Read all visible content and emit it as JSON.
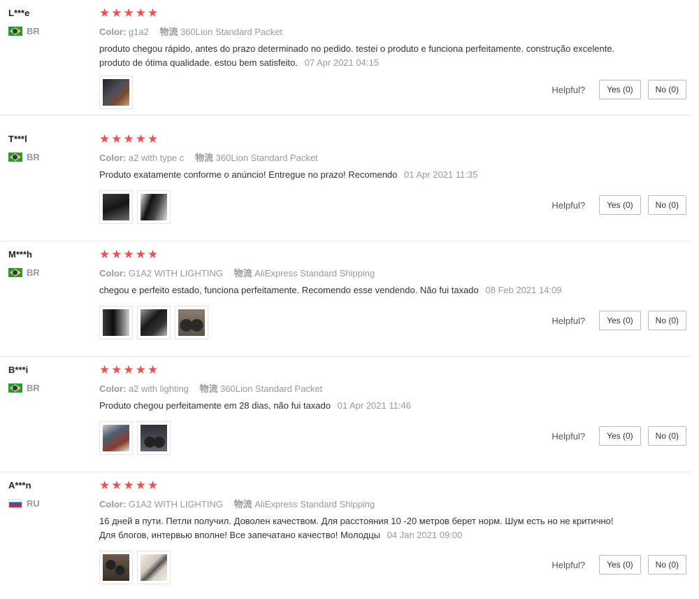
{
  "helpful_label": "Helpful?",
  "stars": "★★★★★",
  "color_label": "Color:",
  "shipping_label": "物流",
  "reviews": [
    {
      "user": "L***e",
      "country": "BR",
      "flag": "flag-br",
      "color": "g1a2",
      "shipping": "360Lion Standard Packet",
      "text": "produto chegou rápido, antes do prazo determinado no pedido. testei o produto e funciona perfeitamente. construção excelente. produto de ótima qualidade. estou bem satisfeito.",
      "date": "07 Apr 2021 04:15",
      "yes": "Yes (0)",
      "no": "No (0)"
    },
    {
      "user": "T***l",
      "country": "BR",
      "flag": "flag-br",
      "color": "a2 with type c",
      "shipping": "360Lion Standard Packet",
      "text": "Produto exatamente conforme o anúncio! Entregue no prazo! Recomendo",
      "date": "01 Apr 2021 11:35",
      "yes": "Yes (0)",
      "no": "No (0)"
    },
    {
      "user": "M***h",
      "country": "BR",
      "flag": "flag-br",
      "color": "G1A2 WITH LIGHTING",
      "shipping": "AliExpress Standard Shipping",
      "text": "chegou e perfeito estado, funciona perfeitamente. Recomendo esse vendendo. Não fui taxado",
      "date": "08 Feb 2021 14:09",
      "yes": "Yes (0)",
      "no": "No (0)"
    },
    {
      "user": "B***i",
      "country": "BR",
      "flag": "flag-br",
      "color": "a2 with lighting",
      "shipping": "360Lion Standard Packet",
      "text": "Produto chegou perfeitamente em 28 dias, não fui taxado",
      "date": "01 Apr 2021 11:46",
      "yes": "Yes (0)",
      "no": "No (0)"
    },
    {
      "user": "A***n",
      "country": "RU",
      "flag": "flag-ru",
      "color": "G1A2 WITH LIGHTING",
      "shipping": "AliExpress Standard Shipping",
      "text": "16 дней в пути. Петли получил. Доволен качеством. Для расстояния 10 -20 метров берет норм. Шум есть но не критично! Для блогов, интервью вполне! Все запечатано качество! Молодцы",
      "date": "04 Jan 2021 09:00",
      "yes": "Yes (0)",
      "no": "No (0)"
    }
  ]
}
